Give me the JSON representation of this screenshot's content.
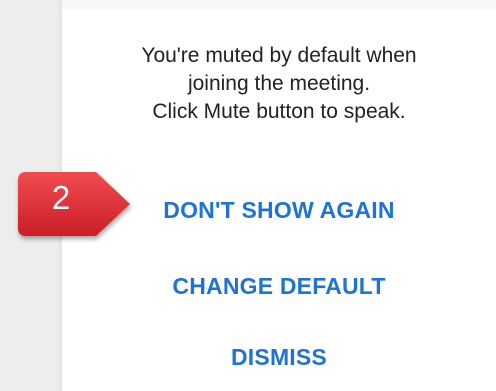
{
  "dialog": {
    "message_lines": [
      "You're muted by default when",
      "joining the meeting.",
      "Click Mute button to speak."
    ],
    "buttons": {
      "dont_show_again": "DON'T SHOW AGAIN",
      "change_default": "CHANGE DEFAULT",
      "dismiss": "DISMISS"
    }
  },
  "annotation": {
    "step_number": "2",
    "marker_color": "#e0262d"
  },
  "colors": {
    "button_text": "#1f73d6",
    "message_text": "#222222",
    "dialog_background": "#ffffff"
  }
}
